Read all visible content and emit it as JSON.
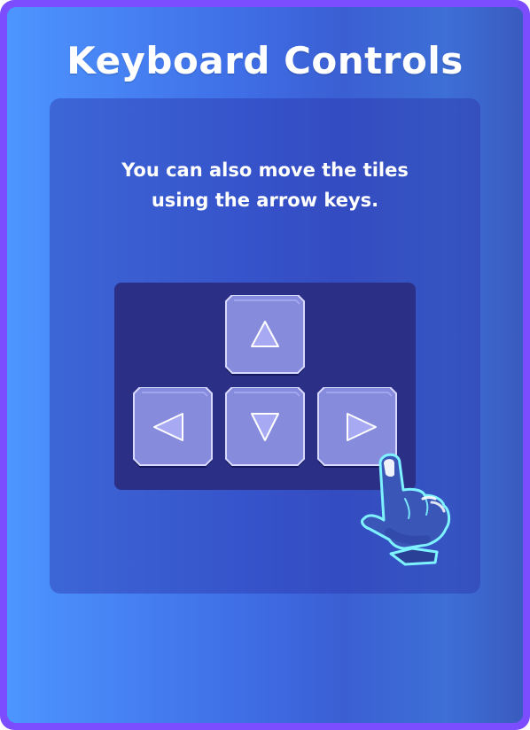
{
  "title": "Keyboard Controls",
  "instruction": "You can also move the tiles\nusing the arrow keys.",
  "colors": {
    "frame": "#7b4dff",
    "panel": "#2c35aa",
    "keypad": "#2b2f86",
    "key_face": "#8b8fe0",
    "key_edge": "#c9ccff",
    "key_shadow": "#16195c",
    "hand": "#3a57b8",
    "hand_outline": "#7ff2ff"
  },
  "keys": [
    {
      "name": "arrow-up",
      "icon": "triangle-up-icon"
    },
    {
      "name": "arrow-left",
      "icon": "triangle-left-icon"
    },
    {
      "name": "arrow-down",
      "icon": "triangle-down-icon"
    },
    {
      "name": "arrow-right",
      "icon": "triangle-right-icon"
    }
  ],
  "pointer": {
    "icon": "pointing-hand-icon"
  }
}
